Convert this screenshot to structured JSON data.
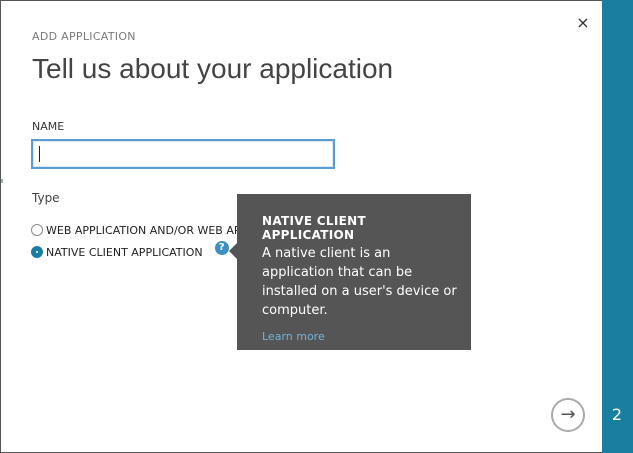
{
  "dialog": {
    "supertitle": "ADD APPLICATION",
    "title": "Tell us about your application",
    "close_icon": "×",
    "step_number": "2",
    "next_icon": "→"
  },
  "form": {
    "name_label": "NAME",
    "name_value": "",
    "type_label": "Type",
    "options": [
      {
        "label": "WEB APPLICATION AND/OR WEB API",
        "selected": false
      },
      {
        "label": "NATIVE CLIENT APPLICATION",
        "selected": true
      }
    ],
    "help_icon": "?"
  },
  "tooltip": {
    "title": "NATIVE CLIENT APPLICATION",
    "body": "A native client is an application that can be installed on a user's device or computer.",
    "link": "Learn more"
  },
  "colors": {
    "accent": "#1a7ea0",
    "tooltip_bg": "#555555",
    "link": "#6fb3e0"
  }
}
